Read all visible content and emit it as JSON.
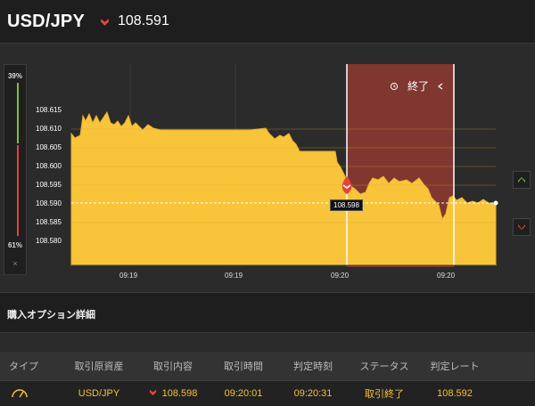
{
  "header": {
    "pair": "USD/JPY",
    "rate": "108.591",
    "direction_icon": "down-arrow-icon",
    "direction_color": "#e5453a"
  },
  "percent_panel": {
    "top_pct": "39%",
    "bottom_pct": "61%",
    "close_label": "×",
    "up_color": "#7cbf3a",
    "down_color": "#d9473b"
  },
  "chart": {
    "expiry_label": "終了",
    "expiry_icon": "clock-rewind-icon",
    "entry_label": "108.598",
    "colors": {
      "fill": "#f8c43a",
      "line": "#e9b12c",
      "expiry_zone": "#8e3a30"
    },
    "y_ticks": [
      "108.615",
      "108.610",
      "108.605",
      "108.600",
      "108.595",
      "108.590",
      "108.585",
      "108.580"
    ],
    "x_ticks": [
      "09:19",
      "09:19",
      "09:20",
      "09:20"
    ],
    "buttons": {
      "up_icon": "chevron-up-icon",
      "down_icon": "chevron-down-icon"
    }
  },
  "section": {
    "title": "購入オプション詳細"
  },
  "table": {
    "headers": [
      "タイプ",
      "取引原資産",
      "取引内容",
      "取引時間",
      "判定時刻",
      "ステータス",
      "判定レート"
    ],
    "rows": [
      {
        "type_icon": "gauge-icon",
        "asset": "USD/JPY",
        "content_icon": "down-arrow-icon",
        "content": "108.598",
        "trade_time": "09:20:01",
        "judge_time": "09:20:31",
        "status": "取引終了",
        "judge_rate": "108.592"
      }
    ]
  }
}
